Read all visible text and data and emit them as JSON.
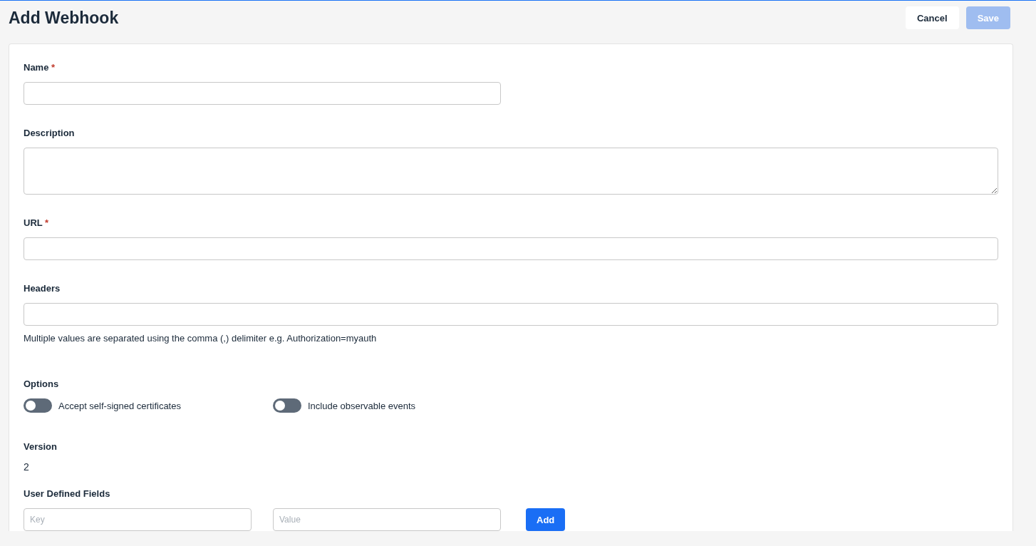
{
  "header": {
    "title": "Add Webhook",
    "buttons": [
      {
        "label": "Cancel",
        "disabled": false
      },
      {
        "label": "Save",
        "disabled": true
      }
    ]
  },
  "fields": [
    {
      "kind": "short-input",
      "label": "Name",
      "required_mark": "*"
    },
    {
      "kind": "textarea",
      "label": "Description"
    },
    {
      "kind": "input",
      "label": "URL",
      "required_mark": "*"
    },
    {
      "kind": "input",
      "label": "Headers",
      "hint": "Multiple values are separated using the comma (,) delimiter e.g. Authorization=myauth"
    }
  ],
  "options": {
    "label": "Options",
    "toggles": [
      {
        "label": "Accept self-signed certificates",
        "on": false
      },
      {
        "label": "Include observable events",
        "on": false
      }
    ]
  },
  "version": {
    "label": "Version",
    "value": "2"
  },
  "user_defined_fields": {
    "label": "User Defined Fields",
    "key_placeholder": "Key",
    "value_placeholder": "Value",
    "add_button": "Add"
  }
}
